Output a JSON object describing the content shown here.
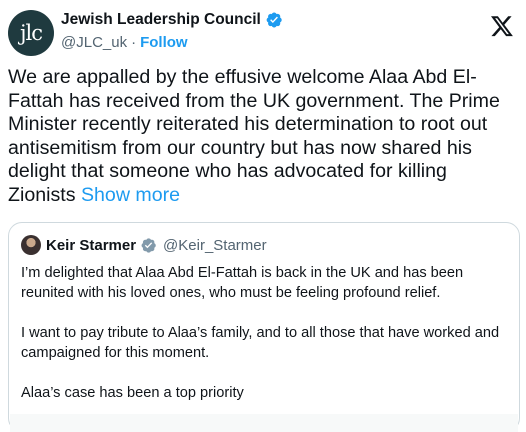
{
  "author": {
    "avatar_text": "jlc",
    "display_name": "Jewish Leadership Council",
    "handle": "@JLC_uk",
    "separator": "·",
    "follow_label": "Follow"
  },
  "tweet": {
    "text": "We are appalled by the effusive welcome Alaa Abd El-Fattah has received from the UK government. The Prime Minister recently reiterated his determination to root out antisemitism from our country but has now shared his delight that someone who has advocated for killing Zionists",
    "show_more_label": "Show more"
  },
  "quoted": {
    "display_name": "Keir Starmer",
    "handle": "@Keir_Starmer",
    "paragraphs": [
      "I’m delighted that Alaa Abd El-Fattah is back in the UK and has been reunited with his loved ones, who must be feeling profound relief.",
      "I want to pay tribute to Alaa’s family, and to all those that have worked and campaigned for this moment.",
      "Alaa’s case has been a top priority"
    ]
  },
  "icons": {
    "verified": "verified-badge-icon",
    "platform": "x-logo-icon"
  },
  "colors": {
    "link": "#1d9bf0",
    "secondary_text": "#536471",
    "verified": "#1d9bf0",
    "avatar_bg": "#1f3a3f"
  }
}
